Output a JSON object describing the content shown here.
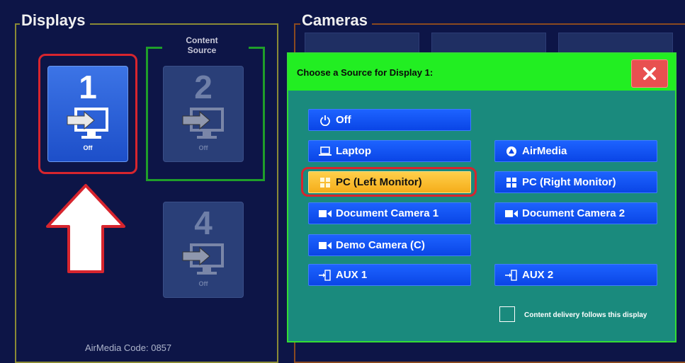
{
  "displays": {
    "title": "Displays",
    "content_source_label": "Content Source",
    "airmedia_code": "AirMedia Code: 0857",
    "tiles": [
      {
        "number": "1",
        "state": "Off"
      },
      {
        "number": "2",
        "state": "Off"
      },
      {
        "number": "4",
        "state": "Off"
      }
    ]
  },
  "cameras": {
    "title": "Cameras"
  },
  "modal": {
    "title": "Choose a Source for Display 1:",
    "close_icon": "close-x",
    "sources": [
      {
        "label": "Off",
        "icon": "power-icon",
        "selected": false
      },
      {
        "label": "Laptop",
        "icon": "laptop-icon",
        "selected": false
      },
      {
        "label": "AirMedia",
        "icon": "airmedia-icon",
        "selected": false
      },
      {
        "label": "PC (Left Monitor)",
        "icon": "windows-icon",
        "selected": true
      },
      {
        "label": "PC (Right Monitor)",
        "icon": "windows-icon",
        "selected": false
      },
      {
        "label": "Document Camera 1",
        "icon": "camera-icon",
        "selected": false
      },
      {
        "label": "Document Camera 2",
        "icon": "camera-icon",
        "selected": false
      },
      {
        "label": "Demo Camera (C)",
        "icon": "camera-icon",
        "selected": false
      },
      {
        "label": "AUX 1",
        "icon": "aux-input-icon",
        "selected": false
      },
      {
        "label": "AUX 2",
        "icon": "aux-input-icon",
        "selected": false
      }
    ],
    "content_delivery_label": "Content delivery follows this display",
    "content_delivery_checked": false
  },
  "colors": {
    "background": "#0d1547",
    "modal_header": "#22ee22",
    "modal_body": "#1a8a7d",
    "source_button": "#0a45e6",
    "selected_button": "#f5ad1a",
    "highlight_outline": "#d7252e"
  }
}
